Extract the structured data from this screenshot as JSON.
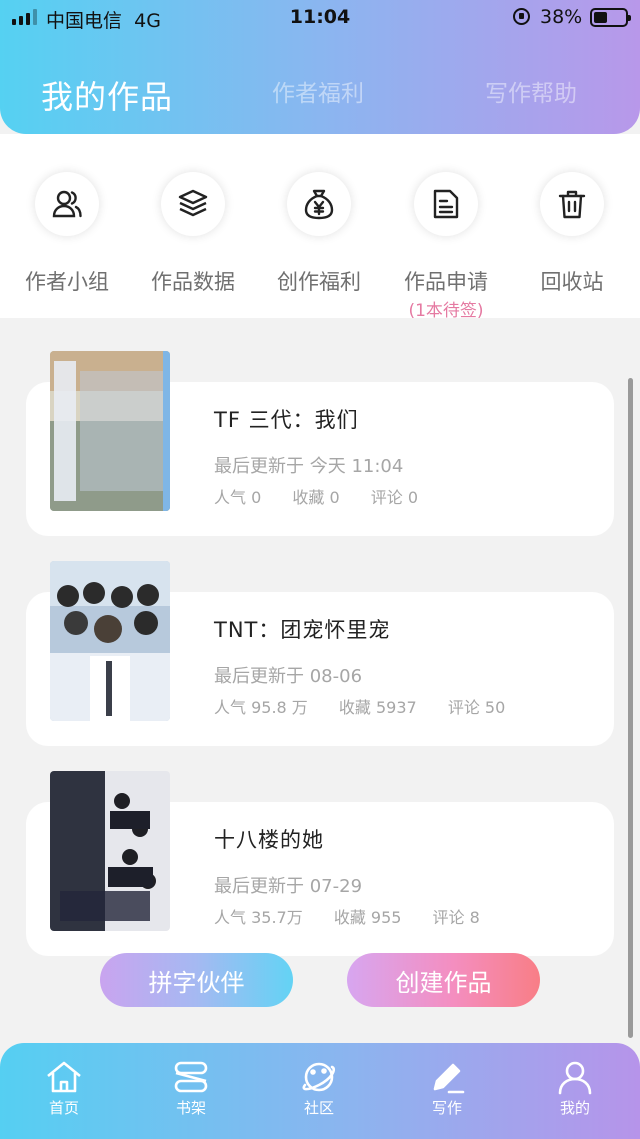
{
  "status_bar": {
    "carrier": "中国电信",
    "network": "4G",
    "time": "11:04",
    "battery": "38%"
  },
  "header": {
    "tabs": [
      {
        "label": "我的作品",
        "active": true
      },
      {
        "label": "作者福利",
        "active": false
      },
      {
        "label": "写作帮助",
        "active": false
      }
    ]
  },
  "tools": [
    {
      "label": "作者小组",
      "icon": "users-icon"
    },
    {
      "label": "作品数据",
      "icon": "layers-icon"
    },
    {
      "label": "创作福利",
      "icon": "money-bag-icon"
    },
    {
      "label": "作品申请",
      "sub": "(1本待签)",
      "icon": "document-icon"
    },
    {
      "label": "回收站",
      "icon": "trash-icon"
    }
  ],
  "works": [
    {
      "title": "TF 三代：我们",
      "updated": "最后更新于 今天 11:04",
      "popularity": "人气 0",
      "favorites": "收藏 0",
      "comments": "评论 0"
    },
    {
      "title": "TNT：团宠怀里宠",
      "updated": "最后更新于 08-06",
      "popularity": "人气 95.8 万",
      "favorites": "收藏 5937",
      "comments": "评论 50"
    },
    {
      "title": "十八楼的她",
      "updated": "最后更新于 07-29",
      "popularity": "人气 35.7万",
      "favorites": "收藏 955",
      "comments": "评论 8"
    }
  ],
  "actions": {
    "partner": "拼字伙伴",
    "create": "创建作品"
  },
  "bottom_nav": [
    {
      "label": "首页",
      "icon": "home-icon"
    },
    {
      "label": "书架",
      "icon": "bookshelf-icon"
    },
    {
      "label": "社区",
      "icon": "planet-icon"
    },
    {
      "label": "写作",
      "icon": "pen-icon"
    },
    {
      "label": "我的",
      "icon": "user-icon"
    }
  ],
  "colors": {
    "accent_blue": "#55d1f2",
    "accent_purple": "#b898ea",
    "pending_pink": "#e57aa2",
    "create_red": "#f87e86"
  }
}
